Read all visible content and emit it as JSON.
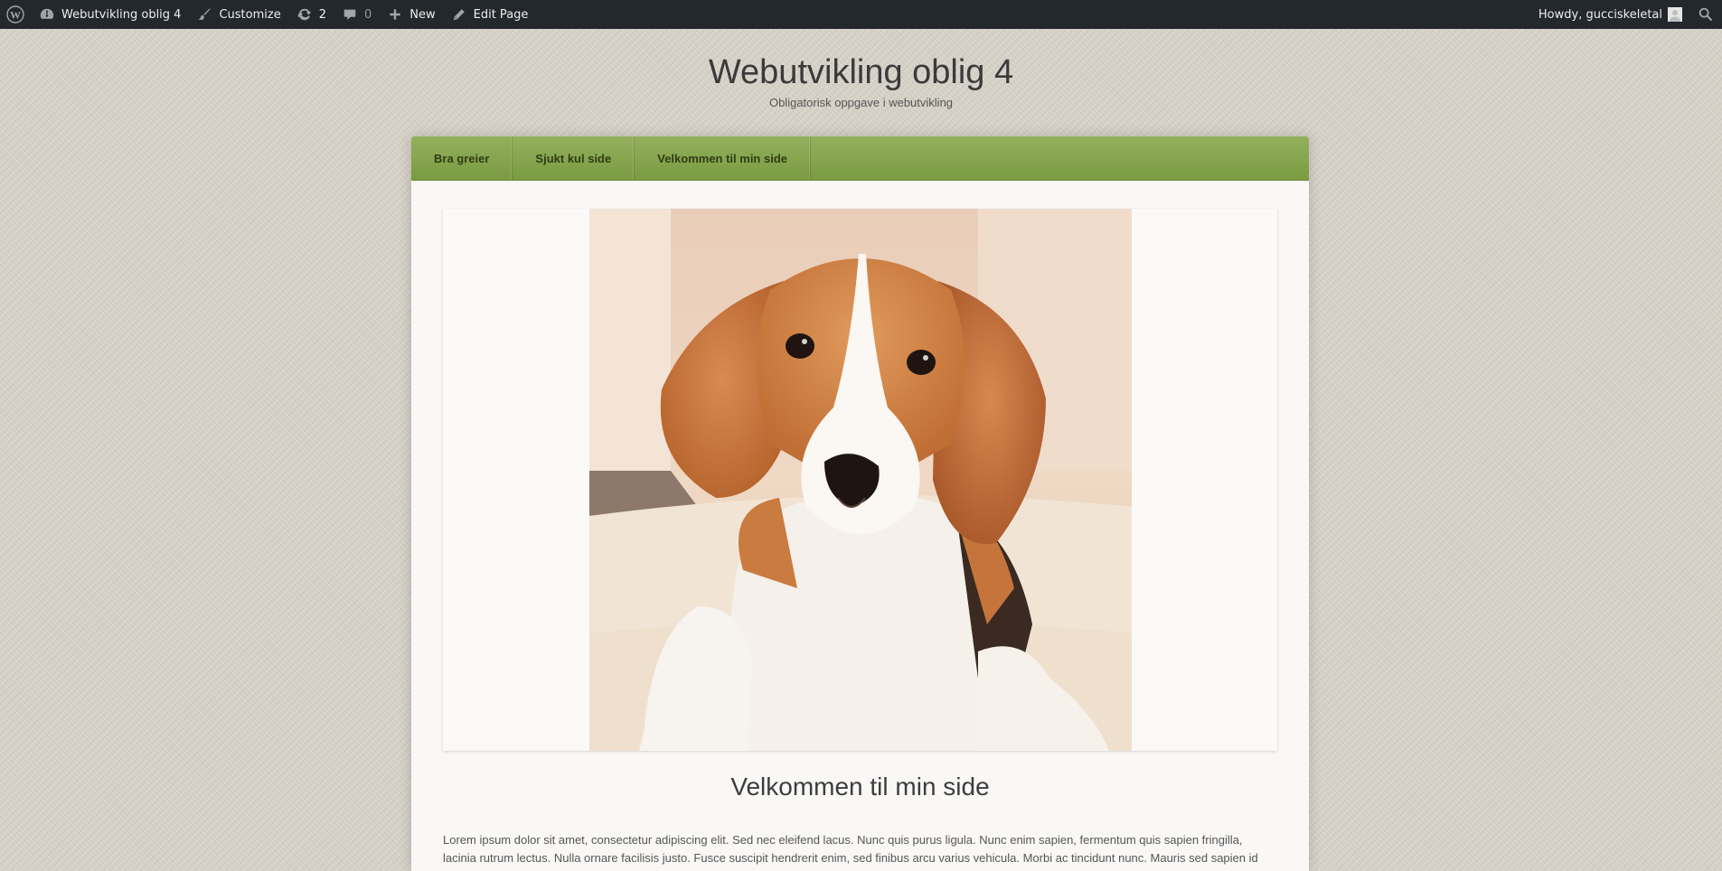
{
  "admin_bar": {
    "site_name": "Webutvikling oblig 4",
    "customize": "Customize",
    "updates_count": "2",
    "comments_count": "0",
    "new_label": "New",
    "edit_page": "Edit Page",
    "howdy": "Howdy, gucciskeletal",
    "icons": [
      "wordpress-icon",
      "dashboard-icon",
      "brush-icon",
      "updates-icon",
      "comment-icon",
      "plus-icon",
      "pencil-icon",
      "avatar",
      "search-icon"
    ]
  },
  "site": {
    "title": "Webutvikling oblig 4",
    "description": "Obligatorisk oppgave i webutvikling"
  },
  "nav": {
    "items": [
      {
        "label": "Bra greier"
      },
      {
        "label": "Sjukt kul side"
      },
      {
        "label": "Velkommen til min side"
      }
    ]
  },
  "page": {
    "image_subject": "beagle puppy lying on a sofa",
    "heading": "Velkommen til min side",
    "body": "Lorem ipsum dolor sit amet, consectetur adipiscing elit. Sed nec eleifend lacus. Nunc quis purus ligula. Nunc enim sapien, fermentum quis sapien fringilla, lacinia rutrum lectus. Nulla ornare facilisis justo. Fusce suscipit hendrerit enim, sed finibus arcu varius vehicula. Morbi ac tincidunt nunc. Mauris sed sapien id"
  },
  "colors": {
    "admin_bar_bg": "#23282d",
    "nav_green": "#86a44f",
    "page_bg": "#d8d3c9",
    "content_bg": "#f9f8f6"
  }
}
